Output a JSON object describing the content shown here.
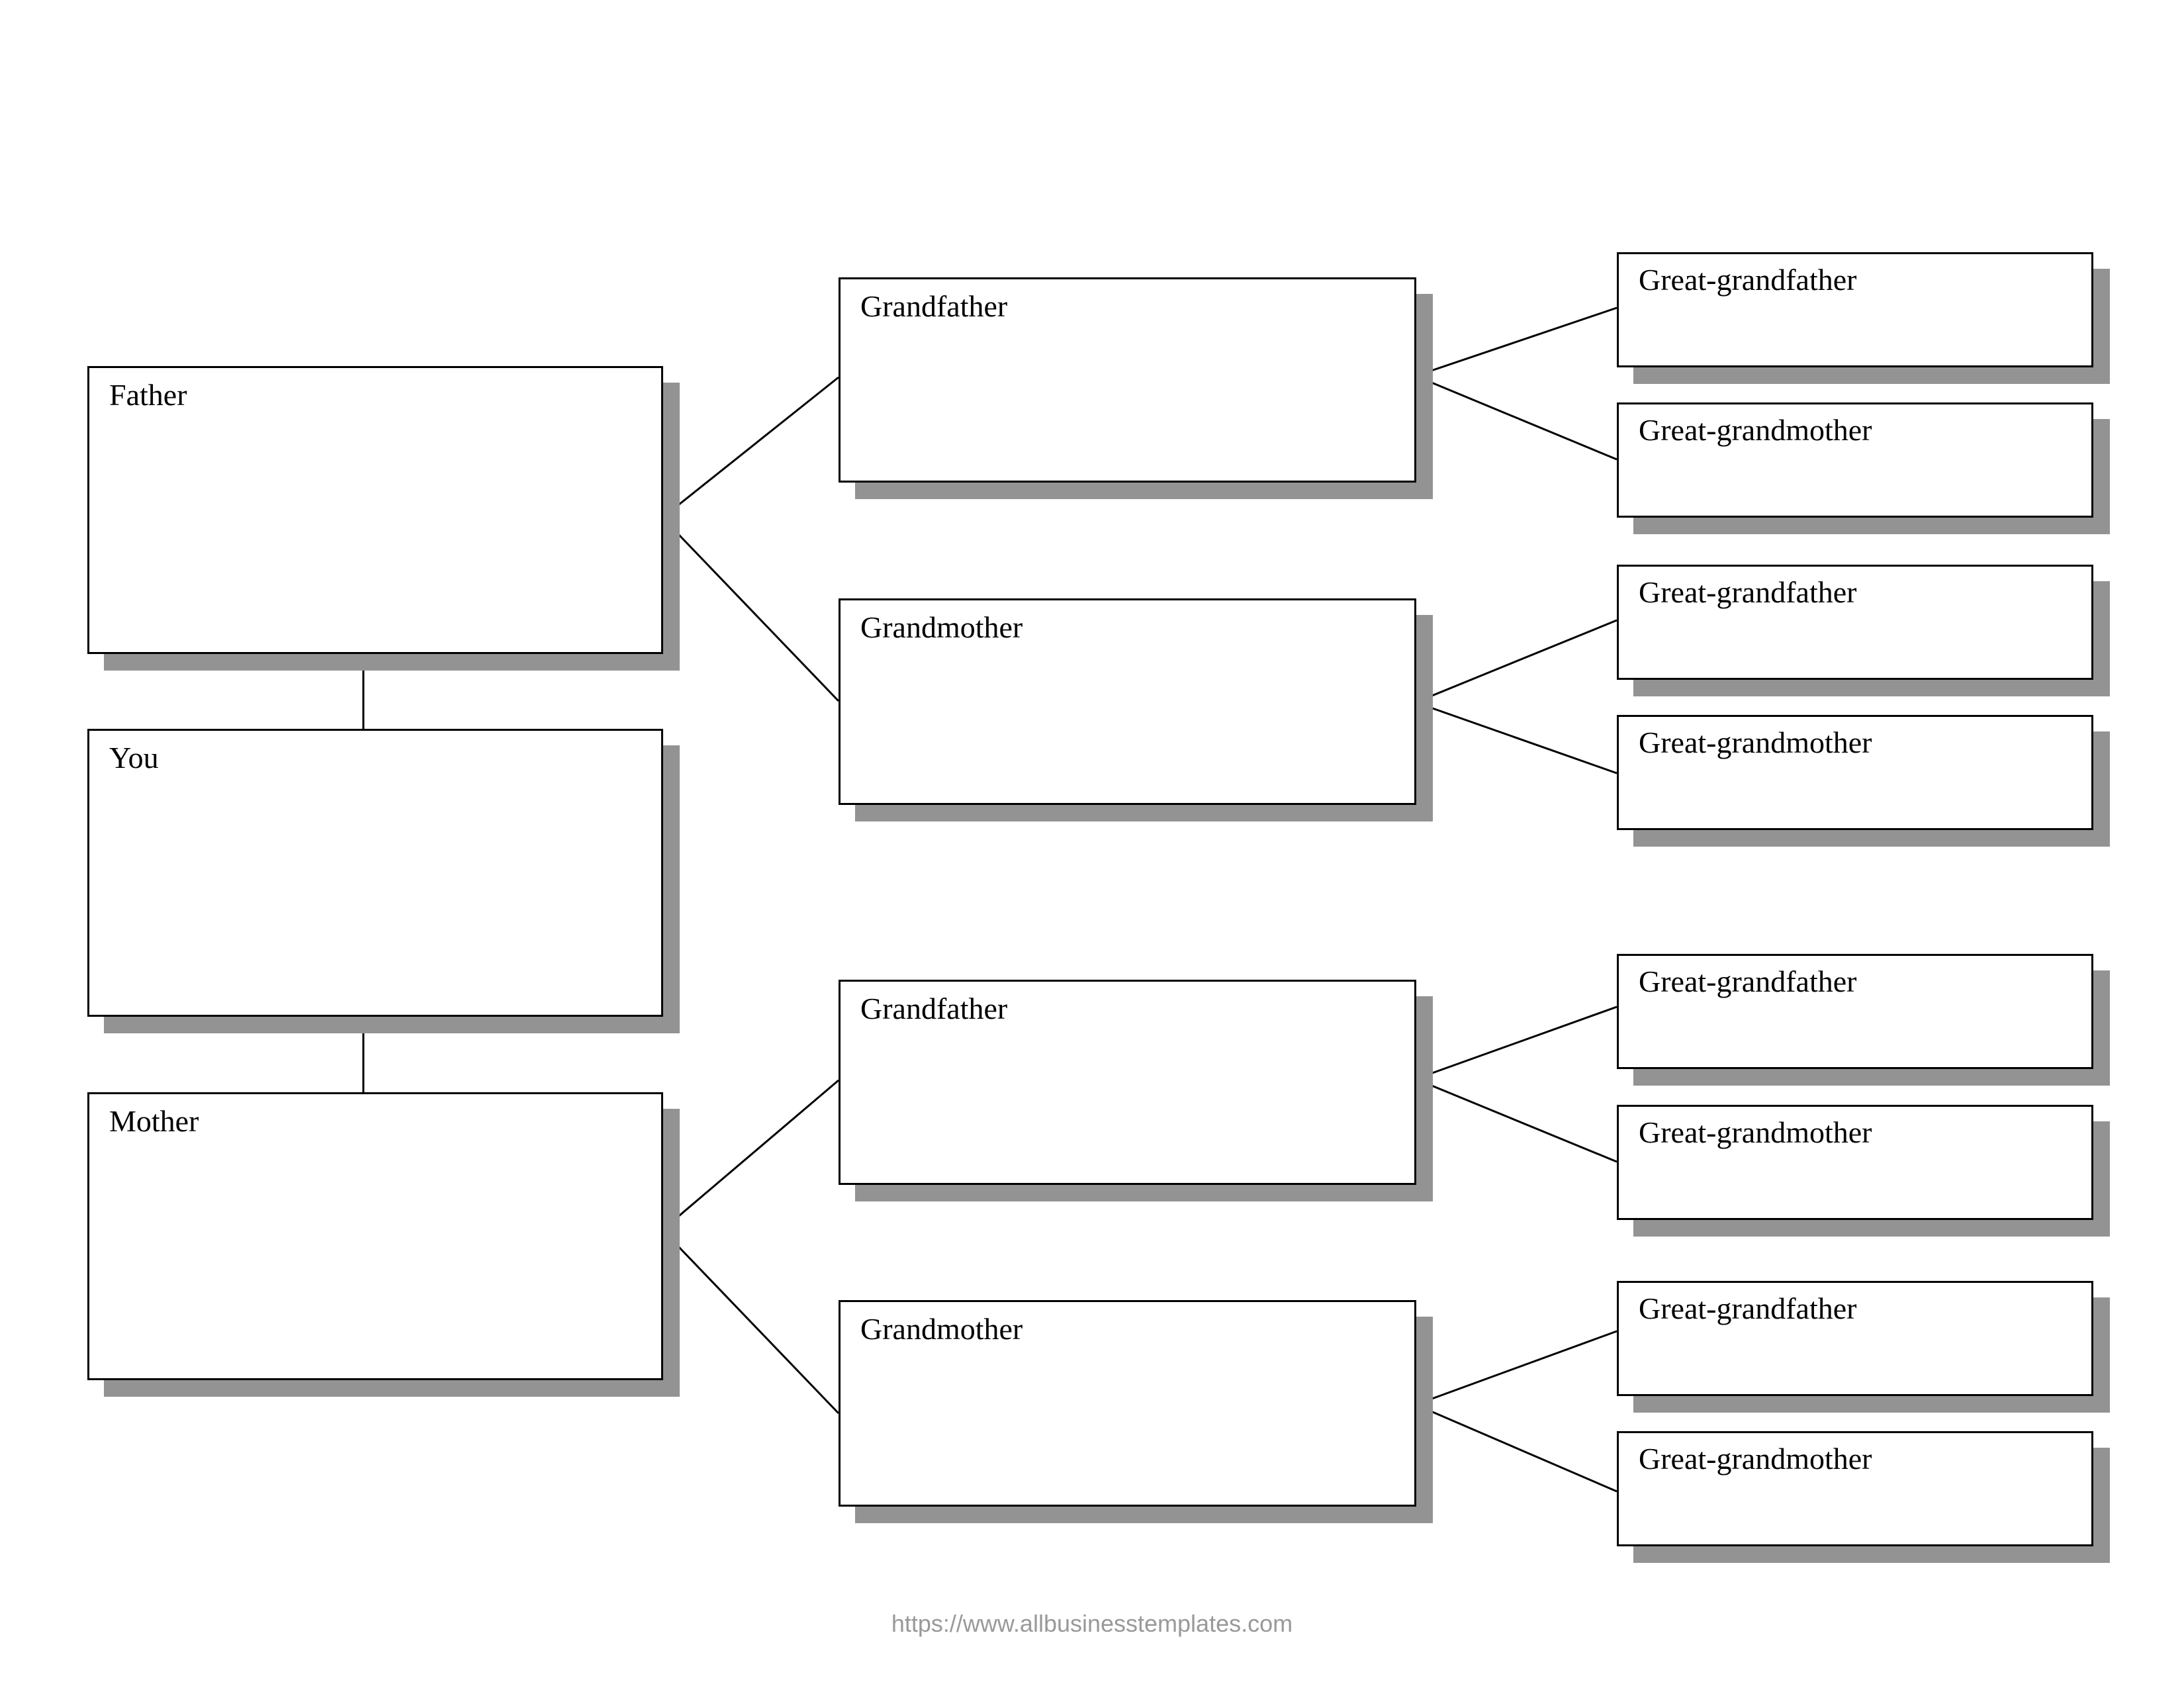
{
  "tree": {
    "self": {
      "label": "You"
    },
    "parents": [
      {
        "label": "Father"
      },
      {
        "label": "Mother"
      }
    ],
    "grandparents": [
      {
        "label": "Grandfather"
      },
      {
        "label": "Grandmother"
      },
      {
        "label": "Grandfather"
      },
      {
        "label": "Grandmother"
      }
    ],
    "great_grandparents": [
      {
        "label": "Great-grandfather"
      },
      {
        "label": "Great-grandmother"
      },
      {
        "label": "Great-grandfather"
      },
      {
        "label": "Great-grandmother"
      },
      {
        "label": "Great-grandfather"
      },
      {
        "label": "Great-grandmother"
      },
      {
        "label": "Great-grandfather"
      },
      {
        "label": "Great-grandmother"
      }
    ]
  },
  "footer": {
    "text": "https://www.allbusinesstemplates.com"
  }
}
